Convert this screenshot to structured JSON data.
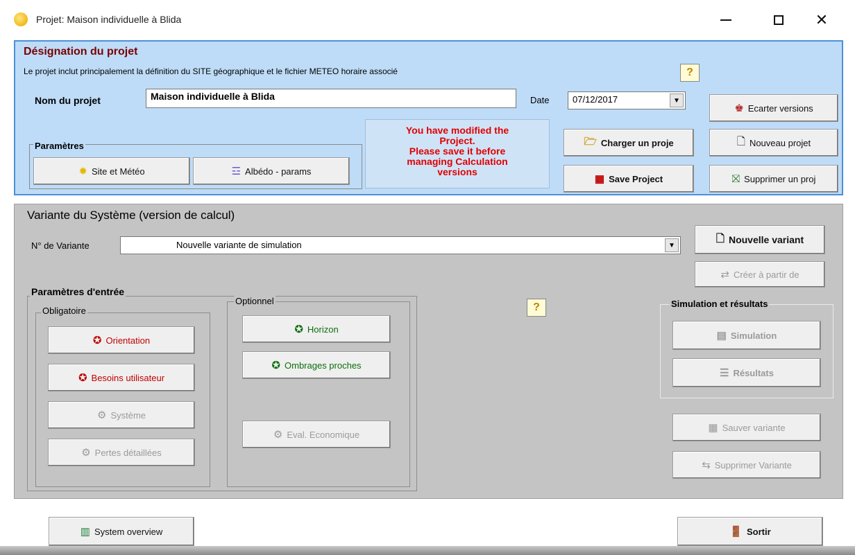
{
  "window": {
    "title": "Projet: Maison individuelle à Blida",
    "controls": {
      "minimize": "—",
      "maximize": "☐",
      "close": "✕"
    }
  },
  "project": {
    "section_title": "Désignation du projet",
    "description": "Le projet inclut principalement la définition du SITE géographique et le fichier METEO horaire associé",
    "help": "?",
    "name_label": "Nom du projet",
    "name_value": "Maison individuelle à Blida",
    "date_label": "Date",
    "date_value": "07/12/2017",
    "params_label": "Paramètres",
    "btn_site": "Site et Météo",
    "btn_albedo": "Albédo - params",
    "warning_lines": [
      "You have modified the",
      "Project.",
      "Please save it before",
      "managing Calculation",
      "versions"
    ],
    "btn_charger": "Charger un proje",
    "btn_save": "Save Project",
    "btn_ecarter": "Ecarter versions",
    "btn_nouveau": "Nouveau projet",
    "btn_supprimer": "Supprimer un proj"
  },
  "variant": {
    "section_title": "Variante du Système (version de calcul)",
    "num_label": "N° de Variante",
    "select_value": "Nouvelle variante de simulation",
    "btn_nouvelle": "Nouvelle variant",
    "btn_creer": "Créer à partir de",
    "entry_label": "Paramètres d'entrée",
    "oblig_label": "Obligatoire",
    "optionnel_label": "Optionnel",
    "btn_orientation": "Orientation",
    "btn_besoins": "Besoins utilisateur",
    "btn_systeme": "Système",
    "btn_pertes": "Pertes détaillées",
    "btn_horizon": "Horizon",
    "btn_ombrages": "Ombrages proches",
    "btn_eval": "Eval. Economique",
    "help": "?",
    "sim_label": "Simulation et résultats",
    "btn_simulation": "Simulation",
    "btn_resultats": "Résultats",
    "btn_sauver": "Sauver variante",
    "btn_supprimer_variante": "Supprimer Variante"
  },
  "footer": {
    "btn_overview": "System overview",
    "btn_sortir": "Sortir"
  },
  "colors": {
    "project_bg": "#bedcf7",
    "project_border": "#4c8fd9",
    "variant_bg": "#c4c4c4",
    "warning_text": "#e00000",
    "title_red": "#7a0000",
    "optional_green": "#0b6e0b",
    "mandatory_red": "#c00000"
  },
  "icons": {
    "app": "sun-icon",
    "site": "sun-icon",
    "albedo": "albedo-icon",
    "charger": "folder-open-icon",
    "save": "save-icon",
    "ecarter": "versions-icon",
    "nouveau": "new-doc-icon",
    "supprimer": "delete-icon",
    "nouvelle_variante": "new-doc-icon",
    "creer": "copy-icon",
    "orientation": "gear-red-icon",
    "besoins": "gear-red-icon",
    "systeme": "gear-icon",
    "pertes": "gear-icon",
    "horizon": "gear-green-icon",
    "ombrages": "gear-green-icon",
    "eval": "gear-icon",
    "simulation": "simulation-icon",
    "resultats": "results-icon",
    "sauver": "save-variant-icon",
    "supprimer_variante": "delete-variant-icon",
    "overview": "overview-icon",
    "sortir": "exit-icon"
  }
}
